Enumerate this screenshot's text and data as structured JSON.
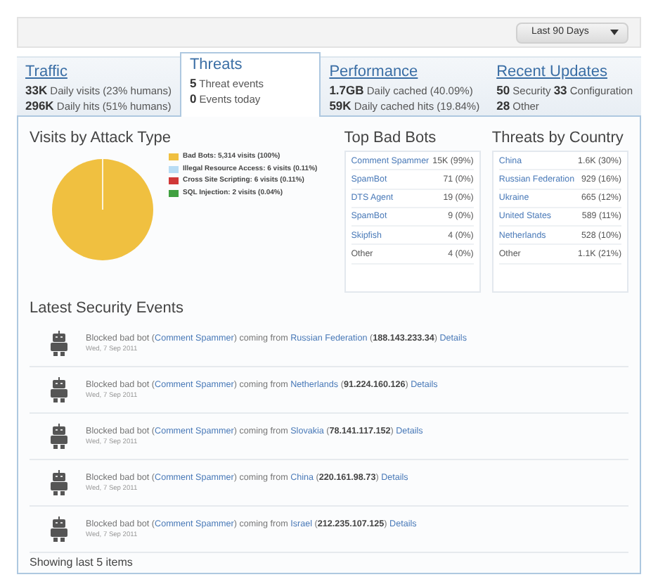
{
  "range_dropdown": {
    "value": "Last 90 Days"
  },
  "tabs": [
    {
      "title": "Traffic",
      "lines": [
        "**33K** Daily visits (23% humans)",
        "**296K** Daily hits (51% humans)"
      ],
      "selected": false
    },
    {
      "title": "Threats",
      "lines": [
        "**5** Threat events",
        "**0** Events today"
      ],
      "selected": true
    },
    {
      "title": "Performance",
      "lines": [
        "**1.7GB** Daily cached (40.09%)",
        "**59K** Daily cached hits (19.84%)"
      ],
      "selected": false
    },
    {
      "title": "Recent Updates",
      "lines": [
        "**50** Security **33** Configuration",
        "**28** Other"
      ],
      "selected": false
    }
  ],
  "attack_types": {
    "title": "Visits by Attack Type",
    "legend": [
      {
        "label": "Bad Bots: 5,314 visits (100%)",
        "color": "#f0c040"
      },
      {
        "label": "Illegal Resource Access: 6 visits (0.11%)",
        "color": "#b8dcf4"
      },
      {
        "label": "Cross Site Scripting: 6 visits (0.11%)",
        "color": "#d03838"
      },
      {
        "label": "SQL Injection: 2 visits (0.04%)",
        "color": "#40a040"
      }
    ]
  },
  "top_bad_bots": {
    "title": "Top Bad Bots",
    "rows": [
      {
        "name": "Comment Spammer",
        "value": "15K (99%)",
        "link": true
      },
      {
        "name": "SpamBot",
        "value": "71 (0%)",
        "link": true
      },
      {
        "name": "DTS Agent",
        "value": "19 (0%)",
        "link": true
      },
      {
        "name": "SpamBot",
        "value": "9 (0%)",
        "link": true
      },
      {
        "name": "Skipfish",
        "value": "4 (0%)",
        "link": true
      },
      {
        "name": "Other",
        "value": "4 (0%)",
        "link": false
      }
    ]
  },
  "threats_by_country": {
    "title": "Threats by Country",
    "rows": [
      {
        "name": "China",
        "value": "1.6K (30%)",
        "link": true
      },
      {
        "name": "Russian Federation",
        "value": "929 (16%)",
        "link": true
      },
      {
        "name": "Ukraine",
        "value": "665 (12%)",
        "link": true
      },
      {
        "name": "United States",
        "value": "589 (11%)",
        "link": true
      },
      {
        "name": "Netherlands",
        "value": "528 (10%)",
        "link": true
      },
      {
        "name": "Other",
        "value": "1.1K (21%)",
        "link": false
      }
    ]
  },
  "security_events": {
    "title": "Latest Security Events",
    "items": [
      {
        "message": [
          {
            "kind": "text",
            "text": "Blocked bad bot ("
          },
          {
            "kind": "link",
            "text": "Comment Spammer"
          },
          {
            "kind": "text",
            "text": ") coming from "
          },
          {
            "kind": "link",
            "text": "Russian Federation"
          },
          {
            "kind": "text",
            "text": " ("
          },
          {
            "kind": "bold",
            "text": "188.143.233.34"
          },
          {
            "kind": "text",
            "text": ") "
          },
          {
            "kind": "link",
            "text": "Details"
          }
        ],
        "date": "Wed, 7 Sep 2011"
      },
      {
        "message": [
          {
            "kind": "text",
            "text": "Blocked bad bot ("
          },
          {
            "kind": "link",
            "text": "Comment Spammer"
          },
          {
            "kind": "text",
            "text": ") coming from "
          },
          {
            "kind": "link",
            "text": "Netherlands"
          },
          {
            "kind": "text",
            "text": " ("
          },
          {
            "kind": "bold",
            "text": "91.224.160.126"
          },
          {
            "kind": "text",
            "text": ") "
          },
          {
            "kind": "link",
            "text": "Details"
          }
        ],
        "date": "Wed, 7 Sep 2011"
      },
      {
        "message": [
          {
            "kind": "text",
            "text": "Blocked bad bot ("
          },
          {
            "kind": "link",
            "text": "Comment Spammer"
          },
          {
            "kind": "text",
            "text": ") coming from "
          },
          {
            "kind": "link",
            "text": "Slovakia"
          },
          {
            "kind": "text",
            "text": " ("
          },
          {
            "kind": "bold",
            "text": "78.141.117.152"
          },
          {
            "kind": "text",
            "text": ") "
          },
          {
            "kind": "link",
            "text": "Details"
          }
        ],
        "date": "Wed, 7 Sep 2011"
      },
      {
        "message": [
          {
            "kind": "text",
            "text": "Blocked bad bot ("
          },
          {
            "kind": "link",
            "text": "Comment Spammer"
          },
          {
            "kind": "text",
            "text": ") coming from "
          },
          {
            "kind": "link",
            "text": "China"
          },
          {
            "kind": "text",
            "text": " ("
          },
          {
            "kind": "bold",
            "text": "220.161.98.73"
          },
          {
            "kind": "text",
            "text": ") "
          },
          {
            "kind": "link",
            "text": "Details"
          }
        ],
        "date": "Wed, 7 Sep 2011"
      },
      {
        "message": [
          {
            "kind": "text",
            "text": "Blocked bad bot ("
          },
          {
            "kind": "link",
            "text": "Comment Spammer"
          },
          {
            "kind": "text",
            "text": ") coming from "
          },
          {
            "kind": "link",
            "text": "Israel"
          },
          {
            "kind": "text",
            "text": " ("
          },
          {
            "kind": "bold",
            "text": "212.235.107.125"
          },
          {
            "kind": "text",
            "text": ") "
          },
          {
            "kind": "link",
            "text": "Details"
          }
        ],
        "date": "Wed, 7 Sep 2011"
      }
    ],
    "footer": "Showing last 5 items"
  }
}
